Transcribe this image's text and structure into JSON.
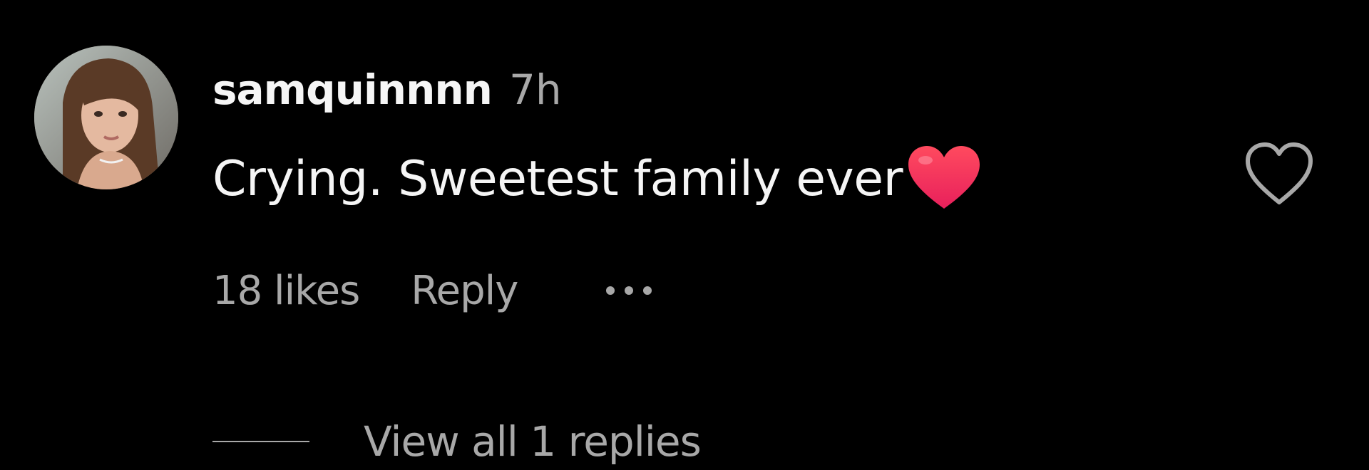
{
  "comment": {
    "username": "samquinnnn",
    "timestamp": "7h",
    "text": "Crying. Sweetest family ever",
    "emoji": "red-heart-emoji",
    "like_icon": "heart-outline-icon",
    "likes": "18 likes",
    "reply_label": "Reply",
    "more_icon": "more-options-icon",
    "view_replies": "View all 1 replies"
  },
  "colors": {
    "background": "#000000",
    "primary_text": "#f5f5f5",
    "secondary_text": "#a8a8a8",
    "heart_emoji": "#f0325a"
  }
}
